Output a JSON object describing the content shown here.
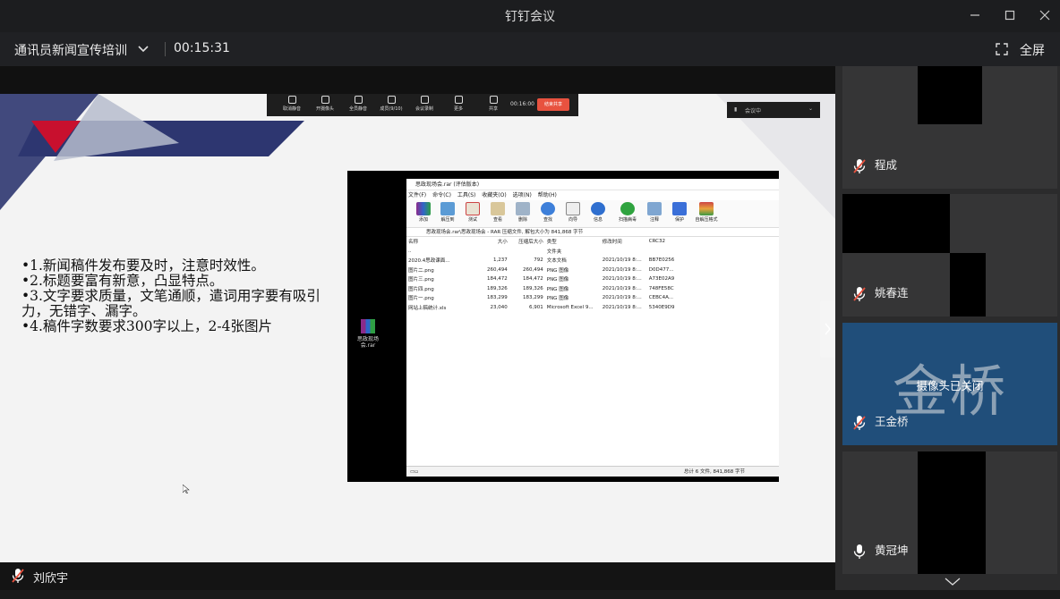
{
  "window": {
    "title": "钉钉会议"
  },
  "header": {
    "meeting_name": "通讯员新闻宣传培训",
    "elapsed": "00:15:31",
    "fullscreen_label": "全屏"
  },
  "share_toolbar": {
    "items": [
      "取消静音",
      "开摄像头",
      "全员静音",
      "成员(9/10)",
      "会议录制",
      "更多",
      "共享"
    ],
    "time": "00:16:00",
    "stop_label": "结束共享",
    "grid_label": "会议中"
  },
  "slide": {
    "bullets": [
      "•1.新闻稿件发布要及时，注意时效性。",
      "•2.标题要富有新意，凸显特点。",
      "•3.文字要求质量，文笔通顺，遣词用字要有吸引力，无错字、漏字。",
      "•4.稿件字数要求300字以上，2-4张图片"
    ]
  },
  "desktop": {
    "icon_label": "思政现场会.rar"
  },
  "winrar": {
    "title": "思政现场会.rar (评估版本)",
    "menu": [
      "文件(F)",
      "命令(C)",
      "工具(S)",
      "收藏夹(O)",
      "选项(N)",
      "帮助(H)"
    ],
    "tools": [
      "添加",
      "解压到",
      "测试",
      "查看",
      "删除",
      "查找",
      "向导",
      "信息",
      "扫描病毒",
      "注释",
      "保护",
      "自解压格式"
    ],
    "path": "思政现场会.rar\\思政现场会 - RAR 压缩文件, 解包大小为 841,868 字节",
    "columns": [
      "名称",
      "大小",
      "压缩后大小",
      "类型",
      "修改时间",
      "CRC32"
    ],
    "rows": [
      [
        "..",
        "",
        "",
        "文件夹",
        "",
        ""
      ],
      [
        "2020.4思政课面...",
        "1,237",
        "792",
        "文本文档",
        "2021/10/19 8:...",
        "BB7E0256"
      ],
      [
        "图片二.png",
        "260,494",
        "260,494",
        "PNG 图像",
        "2021/10/19 8:...",
        "D0D477..."
      ],
      [
        "图片三.png",
        "184,472",
        "184,472",
        "PNG 图像",
        "2021/10/19 8:...",
        "A73E02A9"
      ],
      [
        "图片四.png",
        "189,326",
        "189,326",
        "PNG 图像",
        "2021/10/19 8:...",
        "748FE58C"
      ],
      [
        "图片一.png",
        "183,299",
        "183,299",
        "PNG 图像",
        "2021/10/19 8:...",
        "CEBC4A..."
      ],
      [
        "网站上稿统计.xls",
        "23,040",
        "6,901",
        "Microsoft Excel 9...",
        "2021/10/19 8:...",
        "5340E9D9"
      ]
    ],
    "status": "总计 6 文件, 841,868 字节"
  },
  "speaker": {
    "name": "刘欣宇"
  },
  "participants": [
    {
      "name": "程成"
    },
    {
      "name": "姚春连"
    },
    {
      "name": "王金桥",
      "avatar_text": "金桥",
      "status": "摄像头已关闭"
    },
    {
      "name": "黄冠坤"
    }
  ],
  "colors": {
    "accent_red": "#e8523f",
    "slide_navy": "#2d3670",
    "tile_blue": "#204e7a"
  }
}
